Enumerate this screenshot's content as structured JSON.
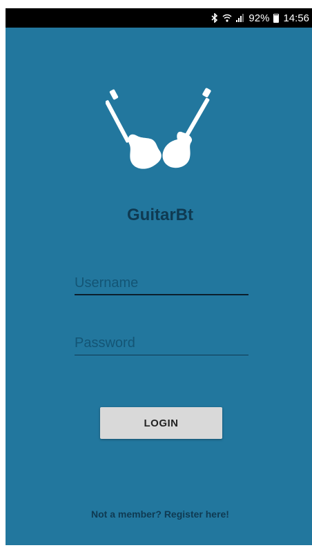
{
  "status_bar": {
    "icons": [
      "bluetooth-icon",
      "wifi-icon",
      "signal-icon",
      "battery-icon"
    ],
    "battery_percent": "92%",
    "time": "14:56"
  },
  "app": {
    "logo_icon": "crossed-guitars-icon",
    "title": "GuitarBt"
  },
  "form": {
    "username_placeholder": "Username",
    "username_value": "",
    "password_placeholder": "Password",
    "password_value": "",
    "login_label": "LOGIN"
  },
  "footer": {
    "register_text": "Not a member? Register here!"
  },
  "colors": {
    "background": "#22779e",
    "title_text": "#0f3a52",
    "button_bg": "#d9d9d9",
    "status_bar": "#000000"
  }
}
